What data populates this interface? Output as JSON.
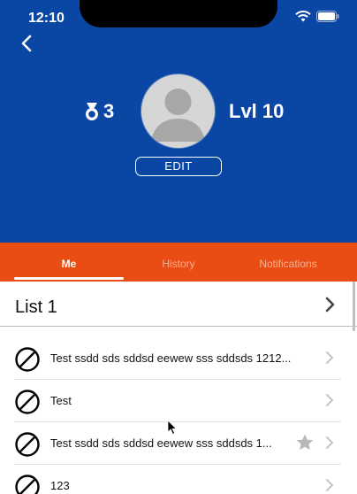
{
  "status": {
    "time": "12:10"
  },
  "profile": {
    "medal_count": "3",
    "level": "Lvl 10",
    "edit_label": "EDIT"
  },
  "tabs": [
    {
      "label": "Me",
      "active": true
    },
    {
      "label": "History",
      "active": false
    },
    {
      "label": "Notifications",
      "active": false
    }
  ],
  "list": {
    "title": "List 1",
    "items": [
      {
        "text": "Test ssdd sds sddsd eewew sss sddsds 1212...",
        "icon": "no-entry-icon",
        "starred": false
      },
      {
        "text": "Test",
        "icon": "no-entry-icon",
        "starred": false
      },
      {
        "text": "Test ssdd sds sddsd eewew sss sddsds 1...",
        "icon": "no-entry-icon",
        "starred": true
      },
      {
        "text": "123",
        "icon": "no-entry-icon",
        "starred": false
      }
    ]
  },
  "colors": {
    "header_blue": "#0a47a4",
    "tab_orange": "#ea4d13",
    "star_gray": "#b8b8b8"
  }
}
